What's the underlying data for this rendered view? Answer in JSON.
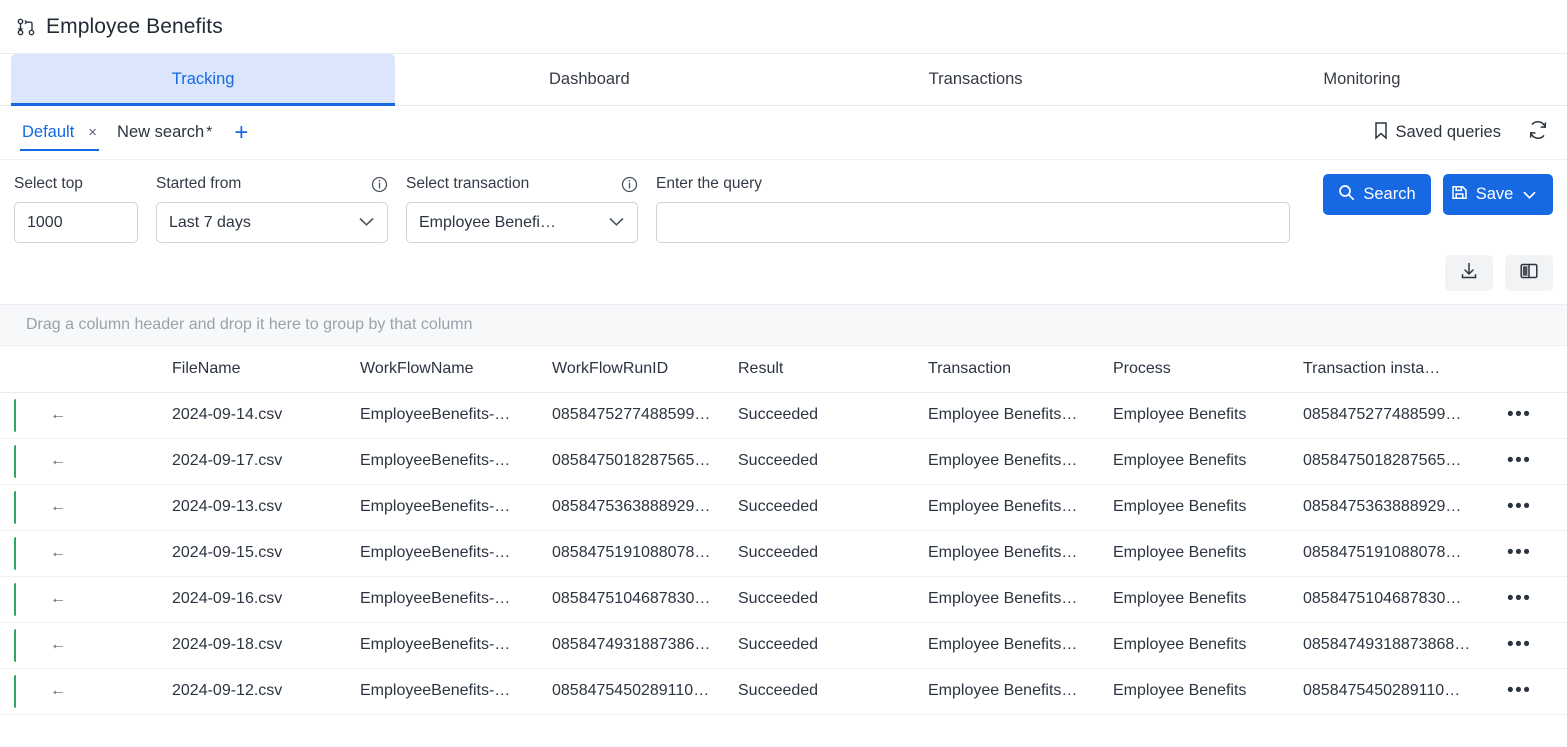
{
  "app": {
    "title": "Employee Benefits",
    "icon": "workflow-icon"
  },
  "main_tabs": [
    {
      "label": "Tracking",
      "active": true
    },
    {
      "label": "Dashboard",
      "active": false
    },
    {
      "label": "Transactions",
      "active": false
    },
    {
      "label": "Monitoring",
      "active": false
    }
  ],
  "query_tabs": {
    "default_tab_label": "Default",
    "close_glyph": "×",
    "new_search_label": "New search",
    "dirty_marker": "*",
    "add_glyph": "+",
    "saved_queries_label": "Saved queries",
    "saved_queries_icon": "bookmark-icon",
    "refresh_icon": "refresh-icon"
  },
  "filters": {
    "select_top": {
      "label": "Select top",
      "value": "1000",
      "placeholder": "1000"
    },
    "started_from": {
      "label": "Started from",
      "value": "Last 7 days",
      "info_icon": "info-icon",
      "chevron_icon": "chevron-down-icon"
    },
    "select_transaction": {
      "label": "Select transaction",
      "value": "Employee Benefi…",
      "info_icon": "info-icon",
      "chevron_icon": "chevron-down-icon"
    },
    "query": {
      "label": "Enter the query",
      "value": "",
      "placeholder": ""
    },
    "search_button": {
      "label": "Search",
      "icon": "search-icon"
    },
    "save_button": {
      "label": "Save",
      "icon": "save-disk-icon",
      "chevron_icon": "chevron-down-icon"
    },
    "accent_color": "#1668e3"
  },
  "icon_toolbar": [
    {
      "name": "download-icon"
    },
    {
      "name": "columns-layout-icon"
    }
  ],
  "grid": {
    "group_hint": "Drag a column header and drop it here to group by that column",
    "columns": [
      "FileName",
      "WorkFlowName",
      "WorkFlowRunID",
      "Result",
      "Transaction",
      "Process",
      "Transaction insta…"
    ],
    "row_arrow_glyph": "←",
    "row_menu_glyph": "•••",
    "status_color": "#29aa5f",
    "rows": [
      {
        "filename": "2024-09-14.csv",
        "workflowname": "EmployeeBenefits-…",
        "workflowrunid": "0858475277488599…",
        "result": "Succeeded",
        "transaction": "Employee Benefits…",
        "process": "Employee Benefits",
        "transaction_instance": "0858475277488599…"
      },
      {
        "filename": "2024-09-17.csv",
        "workflowname": "EmployeeBenefits-…",
        "workflowrunid": "0858475018287565…",
        "result": "Succeeded",
        "transaction": "Employee Benefits…",
        "process": "Employee Benefits",
        "transaction_instance": "0858475018287565…"
      },
      {
        "filename": "2024-09-13.csv",
        "workflowname": "EmployeeBenefits-…",
        "workflowrunid": "0858475363888929…",
        "result": "Succeeded",
        "transaction": "Employee Benefits…",
        "process": "Employee Benefits",
        "transaction_instance": "0858475363888929…"
      },
      {
        "filename": "2024-09-15.csv",
        "workflowname": "EmployeeBenefits-…",
        "workflowrunid": "0858475191088078…",
        "result": "Succeeded",
        "transaction": "Employee Benefits…",
        "process": "Employee Benefits",
        "transaction_instance": "0858475191088078…"
      },
      {
        "filename": "2024-09-16.csv",
        "workflowname": "EmployeeBenefits-…",
        "workflowrunid": "0858475104687830…",
        "result": "Succeeded",
        "transaction": "Employee Benefits…",
        "process": "Employee Benefits",
        "transaction_instance": "0858475104687830…"
      },
      {
        "filename": "2024-09-18.csv",
        "workflowname": "EmployeeBenefits-…",
        "workflowrunid": "08584749318873868…",
        "result": "Succeeded",
        "transaction": "Employee Benefits…",
        "process": "Employee Benefits",
        "transaction_instance": "08584749318873868…"
      },
      {
        "filename": "2024-09-12.csv",
        "workflowname": "EmployeeBenefits-…",
        "workflowrunid": "0858475450289110…",
        "result": "Succeeded",
        "transaction": "Employee Benefits…",
        "process": "Employee Benefits",
        "transaction_instance": "0858475450289110…"
      }
    ]
  }
}
